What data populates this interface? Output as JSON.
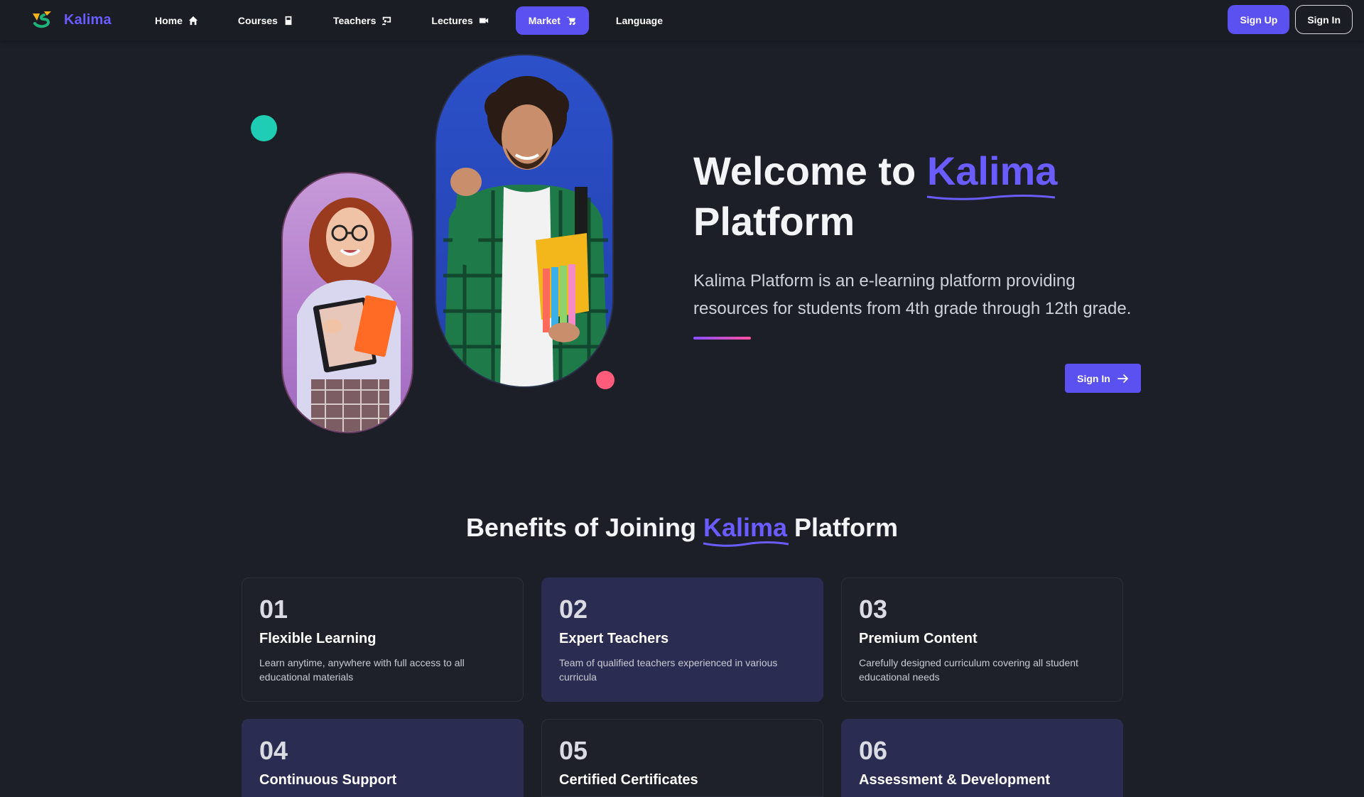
{
  "brand": {
    "name": "Kalima"
  },
  "nav": {
    "items": [
      {
        "label": "Home",
        "icon": "home-icon"
      },
      {
        "label": "Courses",
        "icon": "book-icon"
      },
      {
        "label": "Teachers",
        "icon": "chalkboard-icon"
      },
      {
        "label": "Lectures",
        "icon": "video-icon"
      },
      {
        "label": "Market",
        "icon": "cart-icon",
        "active": true
      },
      {
        "label": "Language",
        "icon": ""
      }
    ],
    "signup_label": "Sign Up",
    "signin_label": "Sign In"
  },
  "hero": {
    "title_prefix": "Welcome to",
    "title_accent": "Kalima",
    "title_suffix": "Platform",
    "description": "Kalima Platform is an e-learning platform providing resources for students from 4th grade through 12th grade.",
    "cta_label": "Sign In"
  },
  "benefits": {
    "title_prefix": "Benefits of Joining",
    "title_accent": "Kalima",
    "title_suffix": "Platform",
    "cards": [
      {
        "num": "01",
        "title": "Flexible Learning",
        "desc": "Learn anytime, anywhere with full access to all educational materials"
      },
      {
        "num": "02",
        "title": "Expert Teachers",
        "desc": "Team of qualified teachers experienced in various curricula"
      },
      {
        "num": "03",
        "title": "Premium Content",
        "desc": "Carefully designed curriculum covering all student educational needs"
      },
      {
        "num": "04",
        "title": "Continuous Support",
        "desc": ""
      },
      {
        "num": "05",
        "title": "Certified Certificates",
        "desc": ""
      },
      {
        "num": "06",
        "title": "Assessment & Development",
        "desc": ""
      }
    ]
  },
  "colors": {
    "accent": "#5b50f0",
    "teal": "#1ecdb3",
    "pink": "#ff5b7a",
    "background": "#1c1f27"
  }
}
